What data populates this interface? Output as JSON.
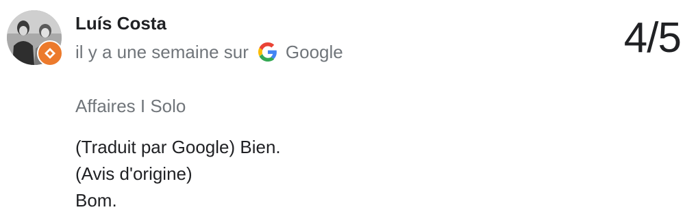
{
  "review": {
    "author": "Luís Costa",
    "time_prefix": "il y a une semaine sur",
    "source": "Google",
    "rating": "4/5",
    "trip_type": "Affaires I Solo",
    "body": {
      "translated": "(Traduit par Google) Bien.",
      "original_label": "(Avis d'origine)",
      "original_text": "Bom."
    }
  },
  "icons": {
    "avatar_badge": "local-guide-icon",
    "source_logo": "google-g-icon"
  },
  "colors": {
    "badge": "#ec7a2c",
    "secondary_text": "#70757a",
    "primary_text": "#202124"
  }
}
